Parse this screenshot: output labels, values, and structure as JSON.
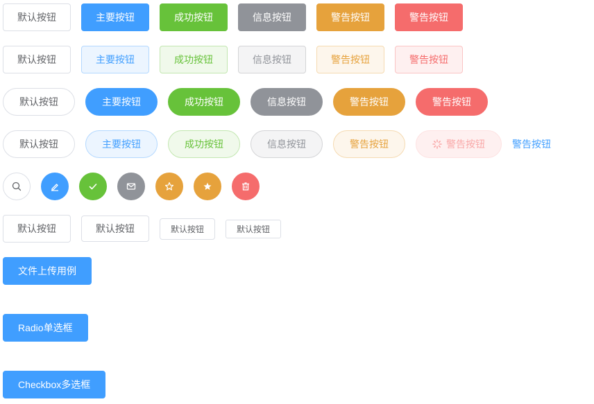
{
  "rows": {
    "basic": [
      "默认按钮",
      "主要按钮",
      "成功按钮",
      "信息按钮",
      "警告按钮",
      "警告按钮"
    ],
    "plain": [
      "默认按钮",
      "主要按钮",
      "成功按钮",
      "信息按钮",
      "警告按钮",
      "警告按钮"
    ],
    "round": [
      "默认按钮",
      "主要按钮",
      "成功按钮",
      "信息按钮",
      "警告按钮",
      "警告按钮"
    ],
    "round_plain": [
      "默认按钮",
      "主要按钮",
      "成功按钮",
      "信息按钮",
      "警告按钮",
      "警告按钮",
      "警告按钮"
    ],
    "sizes": [
      "默认按钮",
      "默认按钮",
      "默认按钮",
      "默认按钮"
    ]
  },
  "icons": [
    "search-icon",
    "edit-icon",
    "check-icon",
    "message-icon",
    "star-outline-icon",
    "star-filled-icon",
    "delete-icon"
  ],
  "nav": {
    "upload": "文件上传用例",
    "radio": "Radio单选框",
    "checkbox": "Checkbox多选框"
  },
  "colors": {
    "primary": "#409eff",
    "success": "#67c23a",
    "info": "#909399",
    "warning": "#e6a23c",
    "danger": "#f56c6c"
  }
}
